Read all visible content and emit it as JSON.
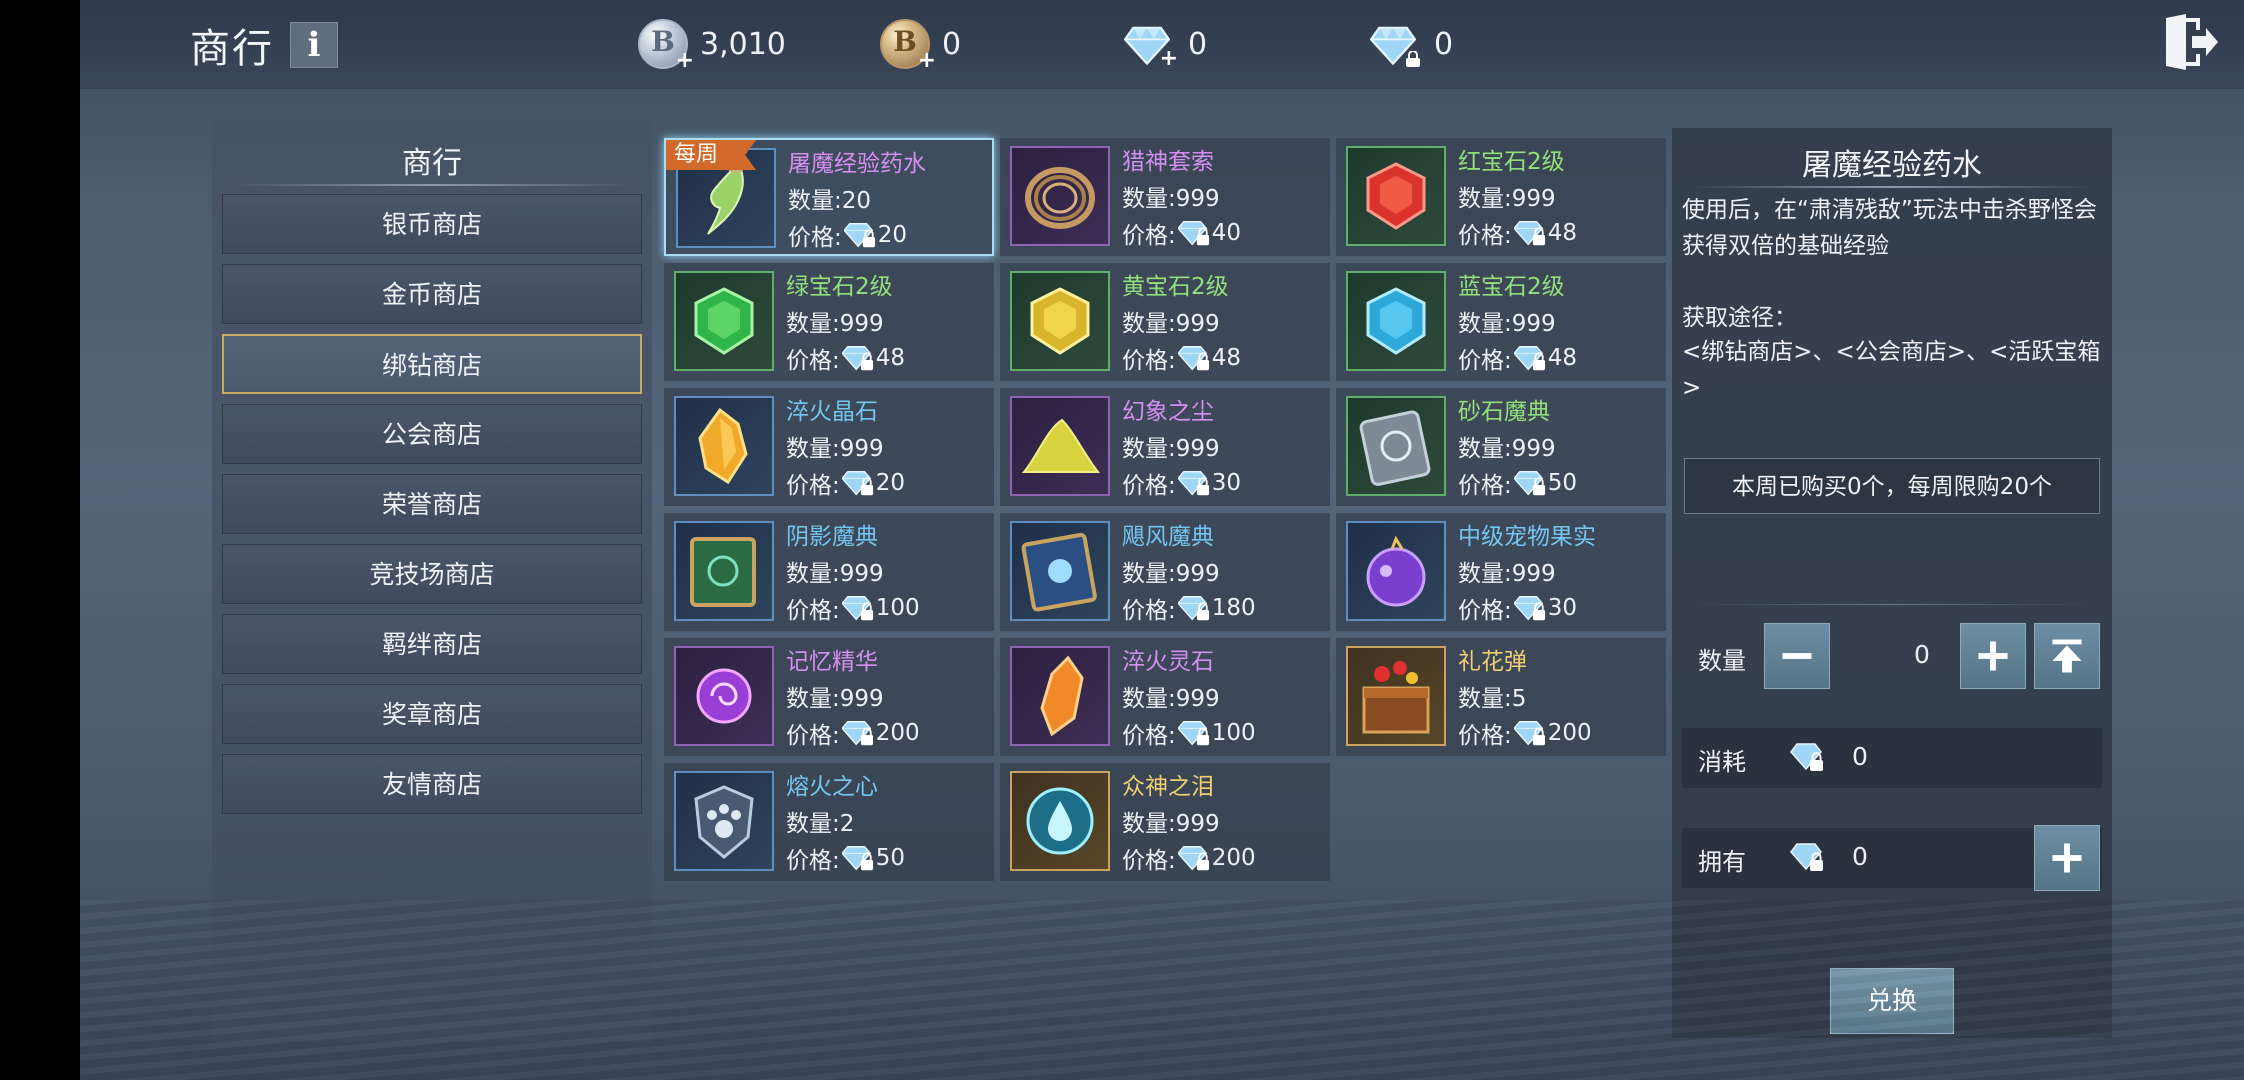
{
  "header": {
    "title": "商行",
    "info_label": "i",
    "currencies": [
      {
        "name": "bound-silver",
        "value": "3,010"
      },
      {
        "name": "bound-gold",
        "value": "0"
      },
      {
        "name": "diamond",
        "value": "0"
      },
      {
        "name": "bound-diamond",
        "value": "0"
      }
    ]
  },
  "sidebar": {
    "title": "商行",
    "items": [
      {
        "label": "银币商店",
        "active": false
      },
      {
        "label": "金币商店",
        "active": false
      },
      {
        "label": "绑钻商店",
        "active": true
      },
      {
        "label": "公会商店",
        "active": false
      },
      {
        "label": "荣誉商店",
        "active": false
      },
      {
        "label": "竞技场商店",
        "active": false
      },
      {
        "label": "羁绊商店",
        "active": false
      },
      {
        "label": "奖章商店",
        "active": false
      },
      {
        "label": "友情商店",
        "active": false
      }
    ]
  },
  "labels": {
    "qty_prefix": "数量:",
    "price_prefix": "价格:",
    "weekly_badge": "每周"
  },
  "items": [
    {
      "name": "屠魔经验药水",
      "qty": "20",
      "price": "20",
      "name_color": "purple",
      "quality": "blue",
      "icon": "horn-potion-icon",
      "weekly": true
    },
    {
      "name": "猎神套索",
      "qty": "999",
      "price": "40",
      "name_color": "purple",
      "quality": "purple",
      "icon": "lasso-icon"
    },
    {
      "name": "红宝石2级",
      "qty": "999",
      "price": "48",
      "name_color": "green",
      "quality": "green",
      "icon": "red-gem-icon"
    },
    {
      "name": "绿宝石2级",
      "qty": "999",
      "price": "48",
      "name_color": "green",
      "quality": "green",
      "icon": "green-gem-icon"
    },
    {
      "name": "黄宝石2级",
      "qty": "999",
      "price": "48",
      "name_color": "green",
      "quality": "green",
      "icon": "yellow-gem-icon"
    },
    {
      "name": "蓝宝石2级",
      "qty": "999",
      "price": "48",
      "name_color": "green",
      "quality": "green",
      "icon": "blue-gem-icon"
    },
    {
      "name": "淬火晶石",
      "qty": "999",
      "price": "20",
      "name_color": "blue",
      "quality": "blue",
      "icon": "amber-crystal-icon"
    },
    {
      "name": "幻象之尘",
      "qty": "999",
      "price": "30",
      "name_color": "purple",
      "quality": "purple",
      "icon": "dust-pile-icon"
    },
    {
      "name": "砂石魔典",
      "qty": "999",
      "price": "50",
      "name_color": "green",
      "quality": "green",
      "icon": "stone-tome-icon"
    },
    {
      "name": "阴影魔典",
      "qty": "999",
      "price": "100",
      "name_color": "blue",
      "quality": "blue",
      "icon": "green-tome-icon"
    },
    {
      "name": "飓风魔典",
      "qty": "999",
      "price": "180",
      "name_color": "blue",
      "quality": "blue",
      "icon": "blue-tome-icon"
    },
    {
      "name": "中级宠物果实",
      "qty": "999",
      "price": "30",
      "name_color": "blue",
      "quality": "blue",
      "icon": "pet-fruit-icon"
    },
    {
      "name": "记忆精华",
      "qty": "999",
      "price": "200",
      "name_color": "purple",
      "quality": "purple",
      "icon": "purple-essence-icon"
    },
    {
      "name": "淬火灵石",
      "qty": "999",
      "price": "100",
      "name_color": "purple",
      "quality": "purple",
      "icon": "orange-crystal-icon"
    },
    {
      "name": "礼花弹",
      "qty": "5",
      "price": "200",
      "name_color": "gold",
      "quality": "gold",
      "icon": "firework-chest-icon"
    },
    {
      "name": "熔火之心",
      "qty": "2",
      "price": "50",
      "name_color": "blue",
      "quality": "blue",
      "icon": "paw-emblem-icon"
    },
    {
      "name": "众神之泪",
      "qty": "999",
      "price": "200",
      "name_color": "gold",
      "quality": "gold",
      "icon": "tear-orb-icon"
    }
  ],
  "detail": {
    "title": "屠魔经验药水",
    "description": "使用后，在“肃清残敌”玩法中击杀野怪会获得双倍的基础经验",
    "source_label": "获取途径：",
    "source_text": "<绑钻商店>、<公会商店>、<活跃宝箱>",
    "limit_text": "本周已购买0个，每周限购20个",
    "quantity_label": "数量",
    "quantity_value": "0",
    "cost_label": "消耗",
    "cost_value": "0",
    "own_label": "拥有",
    "own_value": "0",
    "exchange_label": "兑换"
  },
  "colors": {
    "name_purple": "#d58ff0",
    "name_blue": "#74c6f0",
    "name_green": "#92e07a",
    "name_gold": "#f0cf73",
    "weekly_badge": "#d26a2b",
    "active_border": "#c9a96b",
    "selected_border": "#a9dcf5",
    "button": "#6e8ea4"
  }
}
